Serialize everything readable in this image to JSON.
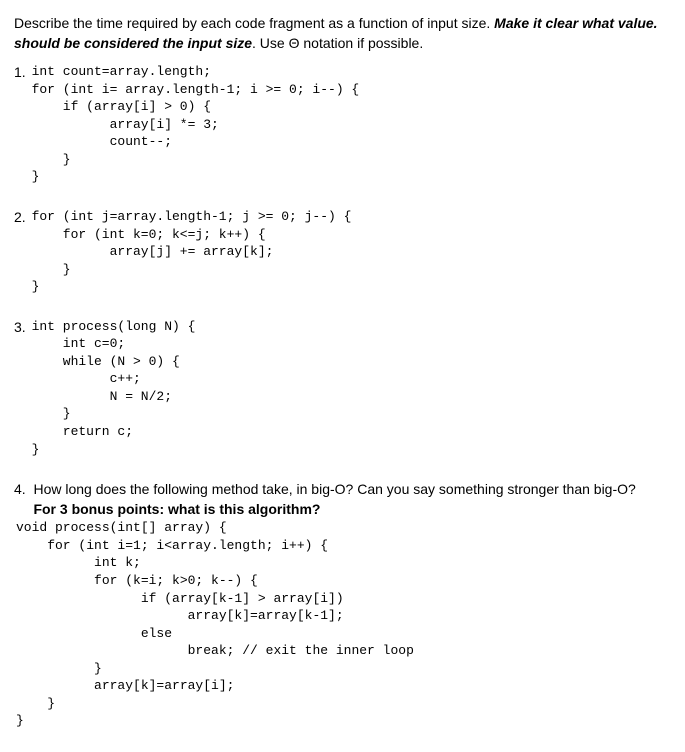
{
  "instructions": {
    "part1": "Describe the time required by each code fragment as a function of input size. ",
    "emphasis1": "Make it clear what value.",
    "emphasis2": "should be considered the input size",
    "part2": ". Use Θ notation if possible."
  },
  "questions": {
    "q1": {
      "num": "1.",
      "code": "int count=array.length;\nfor (int i= array.length-1; i >= 0; i--) {\n    if (array[i] > 0) {\n          array[i] *= 3;\n          count--;\n    }\n}"
    },
    "q2": {
      "num": "2.",
      "code": "for (int j=array.length-1; j >= 0; j--) {\n    for (int k=0; k<=j; k++) {\n          array[j] += array[k];\n    }\n}"
    },
    "q3": {
      "num": "3.",
      "code": "int process(long N) {\n    int c=0;\n    while (N > 0) {\n          c++;\n          N = N/2;\n    }\n    return c;\n}"
    },
    "q4": {
      "num": "4.",
      "intro": "How long does the following method take, in big-O? Can you say something stronger than big-O?",
      "bonus": "For 3 bonus points: what is this algorithm?",
      "code": "void process(int[] array) {\n    for (int i=1; i<array.length; i++) {\n          int k;\n          for (k=i; k>0; k--) {\n                if (array[k-1] > array[i])\n                      array[k]=array[k-1];\n                else\n                      break; // exit the inner loop\n          }\n          array[k]=array[i];\n    }\n}"
    }
  }
}
